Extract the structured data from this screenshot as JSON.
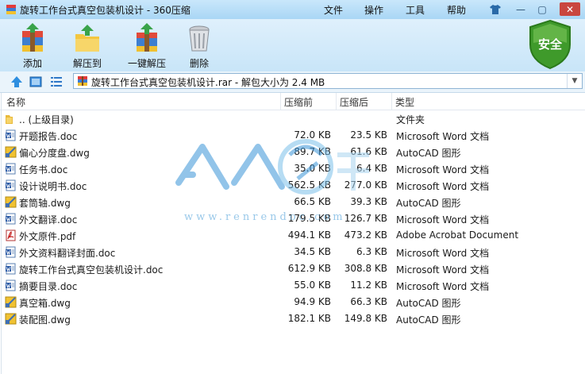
{
  "window": {
    "title": "旋转工作台式真空包装机设计 - 360压缩",
    "menu": [
      "文件",
      "操作",
      "工具",
      "帮助"
    ],
    "security_badge": "安全"
  },
  "toolbar": {
    "add": "添加",
    "extract_to": "解压到",
    "one_click_extract": "一键解压",
    "delete": "删除"
  },
  "address": {
    "text": "旋转工作台式真空包装机设计.rar - 解包大小为 2.4 MB"
  },
  "columns": {
    "name": "名称",
    "size": "压缩前",
    "compressed": "压缩后",
    "type": "类型"
  },
  "files": [
    {
      "name": ".. (上级目录)",
      "size": "",
      "compressed": "",
      "type": "文件夹",
      "icon": "folder-icon"
    },
    {
      "name": "开题报告.doc",
      "size": "72.0 KB",
      "compressed": "23.5 KB",
      "type": "Microsoft Word 文档",
      "icon": "word-doc-icon"
    },
    {
      "name": "偏心分度盘.dwg",
      "size": "89.7 KB",
      "compressed": "61.6 KB",
      "type": "AutoCAD 图形",
      "icon": "dwg-icon"
    },
    {
      "name": "任务书.doc",
      "size": "35.0 KB",
      "compressed": "6.4 KB",
      "type": "Microsoft Word 文档",
      "icon": "word-doc-icon"
    },
    {
      "name": "设计说明书.doc",
      "size": "562.5 KB",
      "compressed": "277.0 KB",
      "type": "Microsoft Word 文档",
      "icon": "word-doc-icon"
    },
    {
      "name": "套筒轴.dwg",
      "size": "66.5 KB",
      "compressed": "39.3 KB",
      "type": "AutoCAD 图形",
      "icon": "dwg-icon"
    },
    {
      "name": "外文翻译.doc",
      "size": "179.5 KB",
      "compressed": "126.7 KB",
      "type": "Microsoft Word 文档",
      "icon": "word-doc-icon"
    },
    {
      "name": "外文原件.pdf",
      "size": "494.1 KB",
      "compressed": "473.2 KB",
      "type": "Adobe Acrobat Document",
      "icon": "pdf-icon"
    },
    {
      "name": "外文资料翻译封面.doc",
      "size": "34.5 KB",
      "compressed": "6.3 KB",
      "type": "Microsoft Word 文档",
      "icon": "word-doc-icon"
    },
    {
      "name": "旋转工作台式真空包装机设计.doc",
      "size": "612.9 KB",
      "compressed": "308.8 KB",
      "type": "Microsoft Word 文档",
      "icon": "word-doc-icon"
    },
    {
      "name": "摘要目录.doc",
      "size": "55.0 KB",
      "compressed": "11.2 KB",
      "type": "Microsoft Word 文档",
      "icon": "word-doc-icon"
    },
    {
      "name": "真空箱.dwg",
      "size": "94.9 KB",
      "compressed": "66.3 KB",
      "type": "AutoCAD 图形",
      "icon": "dwg-icon"
    },
    {
      "name": "装配图.dwg",
      "size": "182.1 KB",
      "compressed": "149.8 KB",
      "type": "AutoCAD 图形",
      "icon": "dwg-icon"
    }
  ],
  "watermark": {
    "url": "www.renrendoc.com"
  }
}
